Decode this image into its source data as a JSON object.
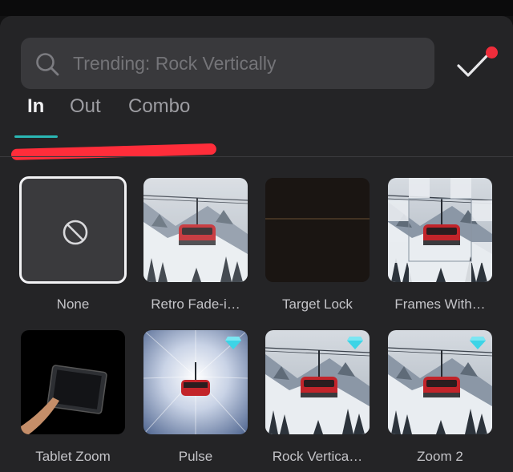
{
  "search": {
    "placeholder": "Trending: Rock Vertically"
  },
  "tabs": [
    {
      "label": "In",
      "active": true
    },
    {
      "label": "Out",
      "active": false
    },
    {
      "label": "Combo",
      "active": false
    }
  ],
  "accent_color": "#2ab7b4",
  "notification_color": "#ef2d3b",
  "effects": [
    {
      "label": "None",
      "selected": true,
      "pro": false
    },
    {
      "label": "Retro Fade-i…",
      "selected": false,
      "pro": false
    },
    {
      "label": "Target Lock",
      "selected": false,
      "pro": false
    },
    {
      "label": "Frames With…",
      "selected": false,
      "pro": false
    },
    {
      "label": "Tablet Zoom",
      "selected": false,
      "pro": false
    },
    {
      "label": "Pulse",
      "selected": false,
      "pro": true
    },
    {
      "label": "Rock Vertica…",
      "selected": false,
      "pro": true
    },
    {
      "label": "Zoom 2",
      "selected": false,
      "pro": true
    }
  ]
}
